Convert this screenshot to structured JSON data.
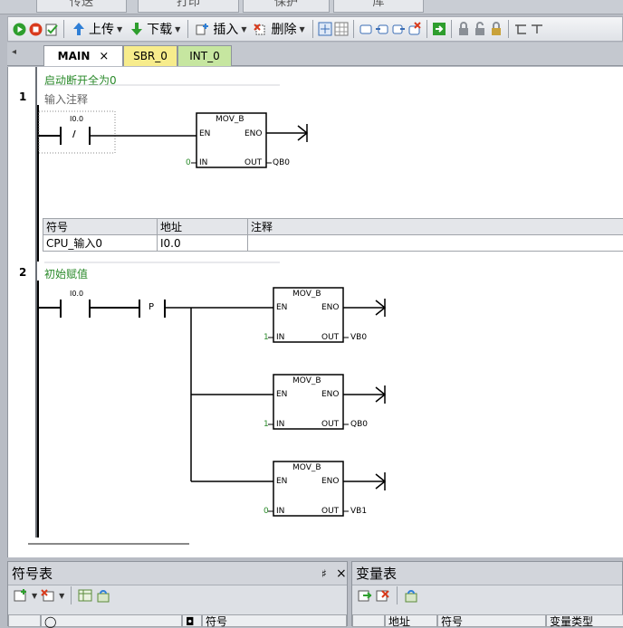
{
  "ribbon": {
    "tabs": [
      "传送",
      "打印",
      "保护",
      "库"
    ]
  },
  "toolbar": {
    "upload": "上传",
    "download": "下载",
    "insert": "插入",
    "delete": "删除"
  },
  "tabs": [
    {
      "label": "MAIN",
      "close": "×"
    },
    {
      "label": "SBR_0"
    },
    {
      "label": "INT_0"
    }
  ],
  "program_comment": "启动断开全为0",
  "networks": [
    {
      "number": "1",
      "comment": "输入注释",
      "contact_addr": "I0.0",
      "contact_sym": "/",
      "box": {
        "name": "MOV_B",
        "en": "EN",
        "eno": "ENO",
        "in": "IN",
        "out": "OUT",
        "in_val": "0",
        "out_val": "QB0"
      },
      "symbol_table": {
        "headers": [
          "符号",
          "地址",
          "注释"
        ],
        "rows": [
          [
            "CPU_输入0",
            "I0.0",
            ""
          ]
        ]
      }
    },
    {
      "number": "2",
      "comment": "初始赋值",
      "contact_addr": "I0.0",
      "edge": "P",
      "boxes": [
        {
          "name": "MOV_B",
          "en": "EN",
          "eno": "ENO",
          "in": "IN",
          "out": "OUT",
          "in_val": "1",
          "out_val": "VB0"
        },
        {
          "name": "MOV_B",
          "en": "EN",
          "eno": "ENO",
          "in": "IN",
          "out": "OUT",
          "in_val": "1",
          "out_val": "QB0"
        },
        {
          "name": "MOV_B",
          "en": "EN",
          "eno": "ENO",
          "in": "IN",
          "out": "OUT",
          "in_val": "0",
          "out_val": "VB1"
        }
      ]
    }
  ],
  "symbol_panel": {
    "title": "符号表",
    "pin": "♯",
    "close": "×",
    "col_symbol": "符号"
  },
  "var_panel": {
    "title": "变量表",
    "col_address": "地址",
    "col_symbol": "符号",
    "col_type": "变量类型"
  },
  "colors": {
    "comment_green": "#2a8a2a",
    "active_tab": "#ffffff",
    "sbr_tab": "#f7ec8c",
    "int_tab": "#c6e6a0"
  }
}
